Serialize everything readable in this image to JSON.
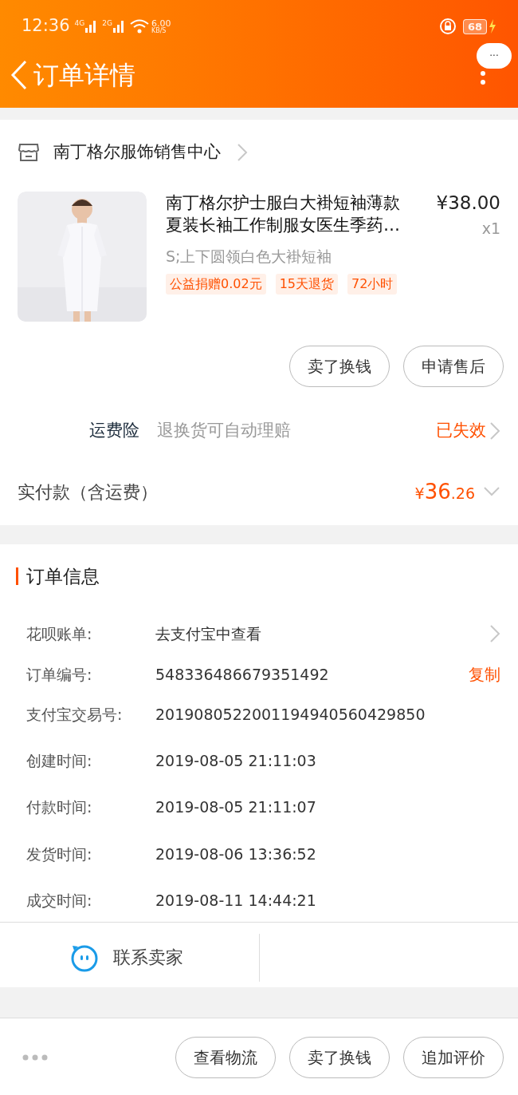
{
  "status_bar": {
    "time": "12:36",
    "net_1": "4G",
    "net_2": "2G",
    "speed": "6.00",
    "speed_unit": "KB/S",
    "battery": "68"
  },
  "header": {
    "title": "订单详情",
    "more": "···"
  },
  "shop": {
    "name": "南丁格尔服饰销售中心"
  },
  "product": {
    "image": {
      "kind": "picture"
    },
    "title": "南丁格尔护士服白大褂短袖薄款夏装长袖工作制服女医生季药…",
    "price": "¥38.00",
    "quantity": "x1",
    "sku": "S;上下圆领白色大褂短袖",
    "tags": [
      "公益捐赠0.02元",
      "15天退货",
      "72小时"
    ],
    "buttons": [
      "卖了换钱",
      "申请售后"
    ]
  },
  "insurance": {
    "label": "运费险",
    "description": "退换货可自动理赔",
    "status": "已失效"
  },
  "payment": {
    "label": "实付款（含运费）",
    "currency": "¥",
    "amount_integer": "36",
    "amount_decimal": ".26"
  },
  "order_info": {
    "title": "订单信息",
    "rows": [
      {
        "label": "花呗账单:",
        "value": "去支付宝中查看",
        "kind": "link"
      },
      {
        "label": "订单编号:",
        "value": "548336486679351492",
        "kind": "copy",
        "action": "复制"
      },
      {
        "label": "支付宝交易号:",
        "value": "2019080522001194940560429850",
        "kind": "plain"
      },
      {
        "label": "创建时间:",
        "value": "2019-08-05 21:11:03",
        "kind": "plain"
      },
      {
        "label": "付款时间:",
        "value": "2019-08-05 21:11:07",
        "kind": "plain"
      },
      {
        "label": "发货时间:",
        "value": "2019-08-06 13:36:52",
        "kind": "plain"
      },
      {
        "label": "成交时间:",
        "value": "2019-08-11 14:44:21",
        "kind": "plain"
      }
    ]
  },
  "contact": {
    "label": "联系卖家"
  },
  "bottom_bar": {
    "buttons": [
      "查看物流",
      "卖了换钱",
      "追加评价"
    ]
  }
}
